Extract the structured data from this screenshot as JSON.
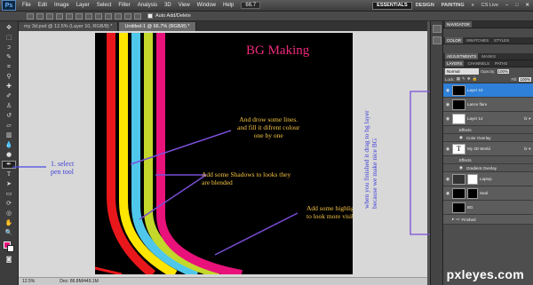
{
  "app": {
    "logo": "Ps"
  },
  "menubar": {
    "items": [
      "File",
      "Edit",
      "Image",
      "Layer",
      "Select",
      "Filter",
      "Analysis",
      "3D",
      "View",
      "Window",
      "Help"
    ],
    "zoom": "66.7",
    "workspaces": [
      "ESSENTIALS",
      "DESIGN",
      "PAINTING"
    ],
    "cs_live": "CS Live"
  },
  "options": {
    "auto_add_delete": "Auto Add/Delete"
  },
  "doc_tabs": [
    {
      "label": "my 3d.psd @ 12.5% (Layer 10, RGB/8) *",
      "active": false
    },
    {
      "label": "Untitled-1 @ 66.7% (RGB/8) *",
      "active": true
    }
  ],
  "statusbar": {
    "zoom": "12.5%",
    "doc": "Doc: 86.8M/449.1M"
  },
  "canvas": {
    "title": "BG Making",
    "notes": [
      "And drow some lines.\nand fill it difrent colour\none by one",
      "Add some Shadows to looks they\nare blended",
      "Add some highlight\nto look more visible"
    ],
    "line_colors": [
      "#e8171b",
      "#ffe600",
      "#4fc7ea",
      "#c3d82a",
      "#e8127a"
    ]
  },
  "annotations": {
    "pen_tool": "1. select\npen tool",
    "drag_note": "when you finished it drag to bg layer\nbecause we make nice BG"
  },
  "panels": {
    "top_tabs": [
      "NAVIGATOR"
    ],
    "color_tabs": [
      "COLOR",
      "SWATCHES",
      "STYLES"
    ],
    "adj_tabs": [
      "ADJUSTMENTS",
      "MASKS"
    ],
    "layer_tabs": [
      "LAYERS",
      "CHANNELS",
      "PATHS"
    ],
    "blend_mode": "Normal",
    "opacity_label": "Opacity:",
    "opacity": "100%",
    "lock_label": "Lock:",
    "fill_label": "Fill:",
    "fill": "100%",
    "layers": [
      {
        "name": "Layer 10",
        "kind": "layer",
        "active": true,
        "fx": false
      },
      {
        "name": "Lance flare",
        "kind": "layer",
        "active": false,
        "fx": false
      },
      {
        "name": "Layer 14",
        "kind": "layer",
        "active": false,
        "fx": true
      },
      {
        "name": "Effects",
        "kind": "sub"
      },
      {
        "name": "Color Overlay",
        "kind": "sub"
      },
      {
        "name": "My 3D World",
        "kind": "text",
        "active": false,
        "fx": true
      },
      {
        "name": "Effects",
        "kind": "sub"
      },
      {
        "name": "Gradient Overlay",
        "kind": "sub"
      },
      {
        "name": "Laptop",
        "kind": "masked",
        "active": false,
        "fx": false
      },
      {
        "name": "Seal",
        "kind": "masked",
        "active": false,
        "fx": false
      },
      {
        "name": "BG",
        "kind": "layer",
        "active": false,
        "fx": false
      },
      {
        "name": "Finshed",
        "kind": "group",
        "active": false,
        "fx": false
      }
    ]
  },
  "watermark": "pxleyes.com"
}
